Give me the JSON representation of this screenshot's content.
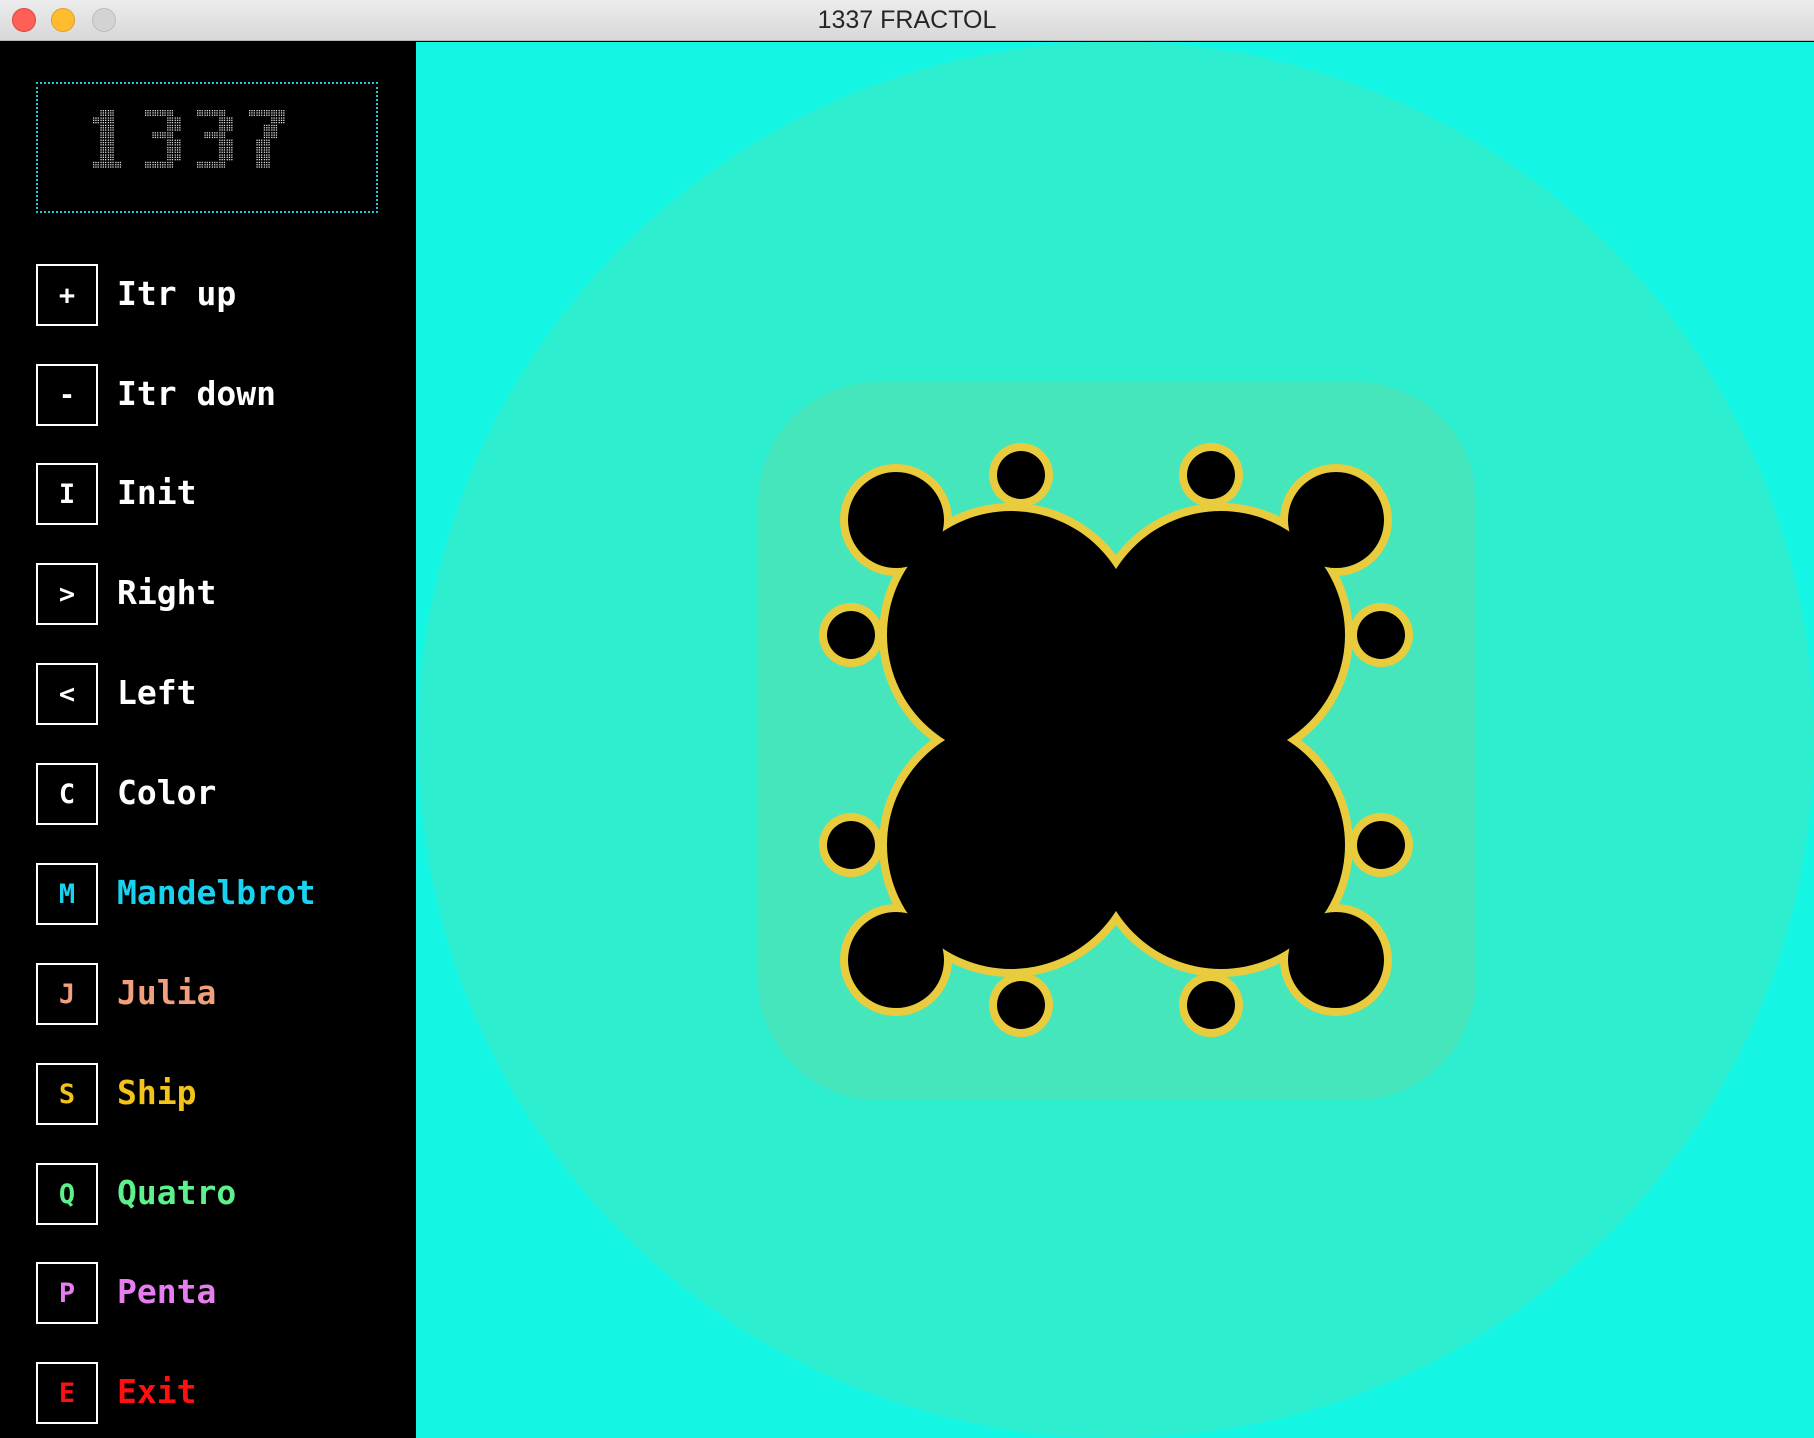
{
  "window": {
    "title": "1337 FRACTOL"
  },
  "logo": {
    "text": "1337"
  },
  "menu": [
    {
      "key": "+",
      "label": "Itr up",
      "color": "#ffffff"
    },
    {
      "key": "-",
      "label": "Itr down",
      "color": "#ffffff"
    },
    {
      "key": "I",
      "label": "Init",
      "color": "#ffffff"
    },
    {
      "key": ">",
      "label": "Right",
      "color": "#ffffff"
    },
    {
      "key": "<",
      "label": "Left",
      "color": "#ffffff"
    },
    {
      "key": "C",
      "label": "Color",
      "color": "#ffffff"
    },
    {
      "key": "M",
      "label": "Mandelbrot",
      "color": "#19d2f0"
    },
    {
      "key": "J",
      "label": "Julia",
      "color": "#f0a07c"
    },
    {
      "key": "S",
      "label": "Ship",
      "color": "#f4c319"
    },
    {
      "key": "Q",
      "label": "Quatro",
      "color": "#5ef08c"
    },
    {
      "key": "P",
      "label": "Penta",
      "color": "#e67ef0"
    },
    {
      "key": "E",
      "label": "Exit",
      "color": "#ff1010"
    }
  ],
  "fractal": {
    "background_color": "#14f5e4",
    "halo_color": "#2eeed0",
    "inner_halo_color": "#45e6bc",
    "border_color": "#e8cc3e",
    "set_color": "#000000"
  }
}
